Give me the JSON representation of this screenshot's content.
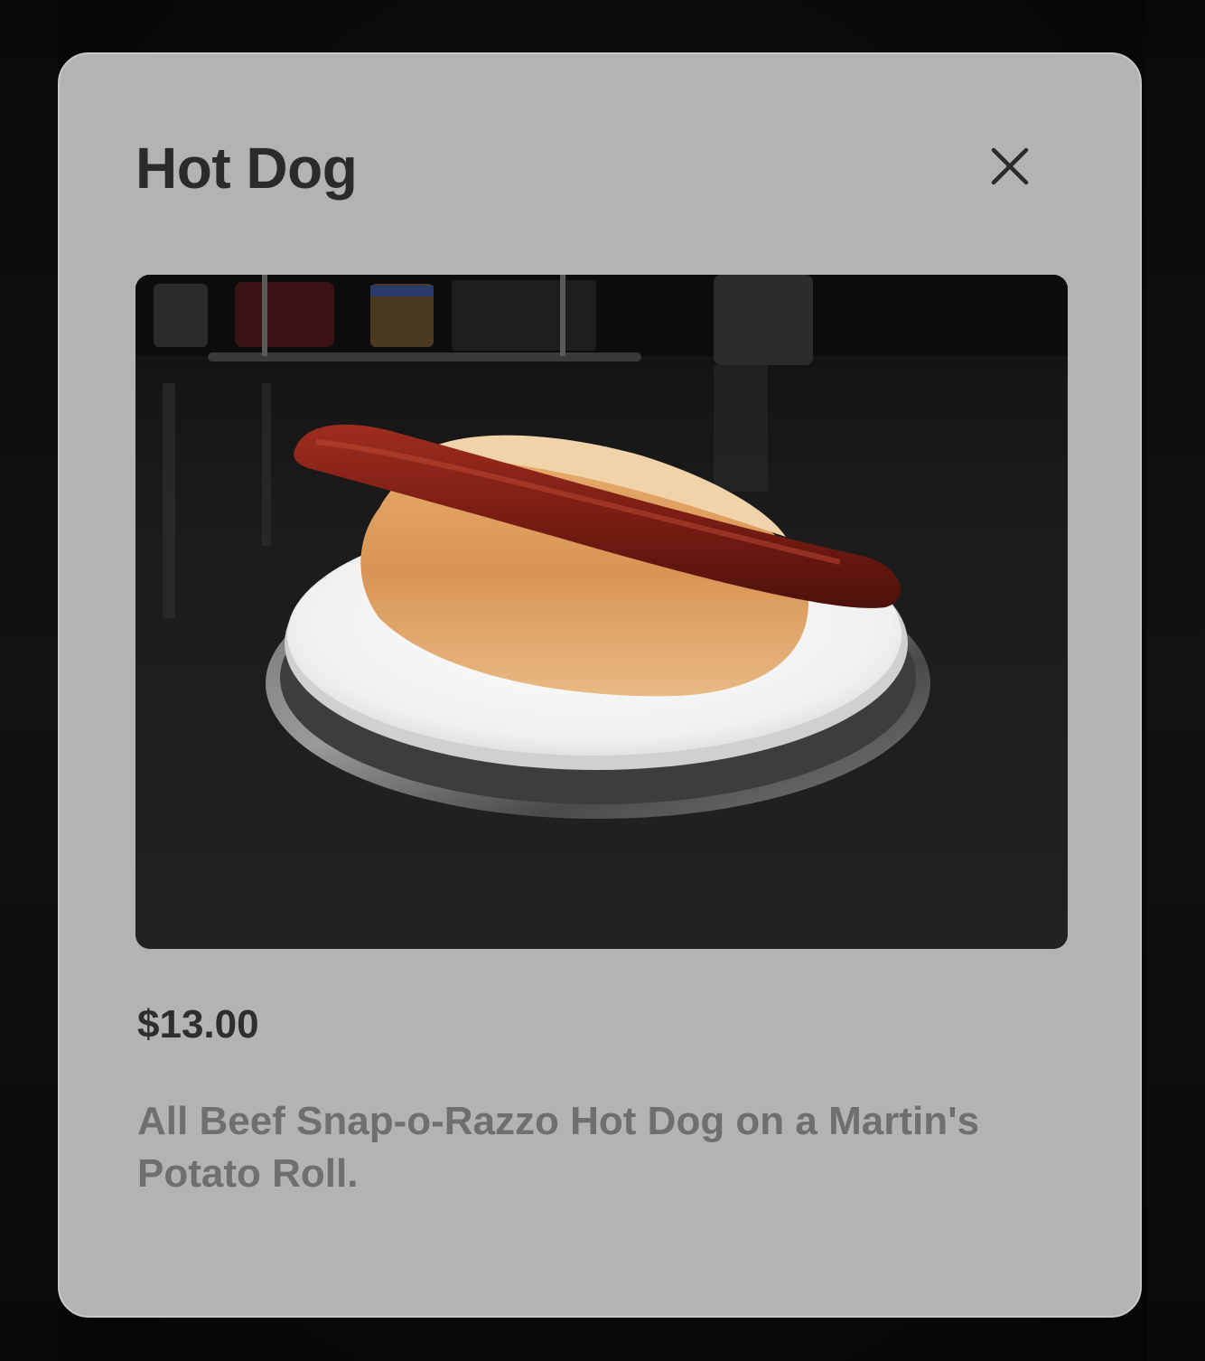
{
  "modal": {
    "title": "Hot Dog",
    "close_icon": "close-icon",
    "image_subject": "hot dog on a bun on a white plate",
    "price": "$13.00",
    "description": "All Beef Snap-o-Razzo Hot Dog on a Martin's Potato Roll."
  },
  "colors": {
    "modal_background": "#b3b3b3",
    "title": "#2b2b2b",
    "price": "#2e2e2e",
    "description": "#6f6f6f",
    "backdrop": "#0d0d0d"
  }
}
